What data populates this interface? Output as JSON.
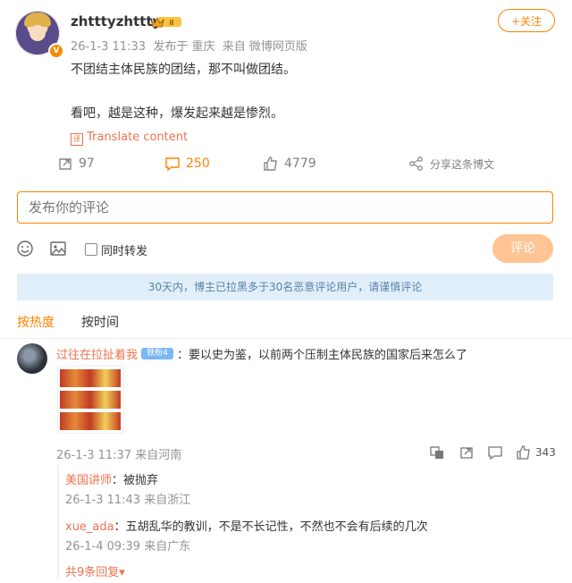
{
  "post": {
    "username": "zhtttyzhttty",
    "crown_label": "Ⅲ",
    "timestamp": "26-1-3 11:33",
    "location": "发布于 重庆",
    "source": "来自 微博网页版",
    "follow_label": "+关注",
    "lines": [
      "不团结主体民族的团结，那不叫做团结。",
      "看吧，越是这种，爆发起来越是惨烈。"
    ],
    "translate_label": "Translate content",
    "actions": {
      "repost_count": "97",
      "comment_count": "250",
      "like_count": "4779",
      "share_label": "分享这条博文"
    },
    "colors": {
      "accent": "#ff8200",
      "link": "#eb7350"
    }
  },
  "composer": {
    "placeholder": "发布你的评论",
    "repost_checkbox_label": "同时转发",
    "submit_label": "评论"
  },
  "notice": "30天内，博主已拉黑多于30名恶意评论用户，请谨慎评论",
  "sort": {
    "hot": "按热度",
    "time": "按时间"
  },
  "comment": {
    "author": "过往在拉扯着我",
    "badge": "铁粉4",
    "text": "：要以史为鉴，以前两个压制主体民族的国家后来怎么了",
    "timestamp": "26-1-3 11:37",
    "location": "来自河南",
    "likes": "343",
    "replies": [
      {
        "author": "美国讲师",
        "text": "：被抛弃",
        "timestamp": "26-1-3 11:43",
        "location": "来自浙江"
      },
      {
        "author": "xue_ada",
        "text": "：五胡乱华的教训，不是不长记性，不然也不会有后续的几次",
        "timestamp": "26-1-4 09:39",
        "location": "来自广东"
      }
    ],
    "more_replies_label": "共9条回复",
    "more_replies_arrow": "▾"
  },
  "badge_v": "V"
}
